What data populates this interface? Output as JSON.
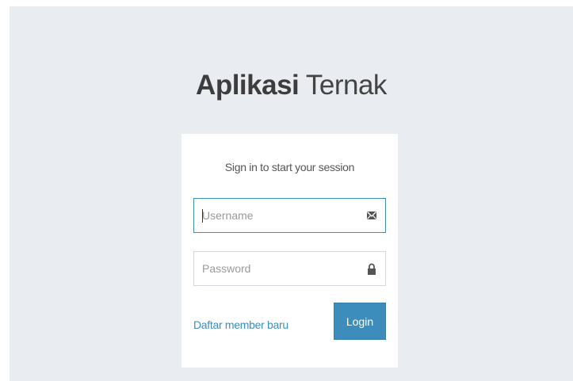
{
  "app": {
    "title_bold": "Aplikasi",
    "title_light": "Ternak"
  },
  "login_box": {
    "message": "Sign in to start your session",
    "username": {
      "placeholder": "Username",
      "value": "",
      "icon": "envelope-icon"
    },
    "password": {
      "placeholder": "Password",
      "value": "",
      "icon": "lock-icon"
    },
    "register_link": "Daftar member baru",
    "login_button": "Login"
  },
  "colors": {
    "background": "#e9ecf1",
    "accent": "#3c8dbc",
    "box": "#ffffff"
  }
}
